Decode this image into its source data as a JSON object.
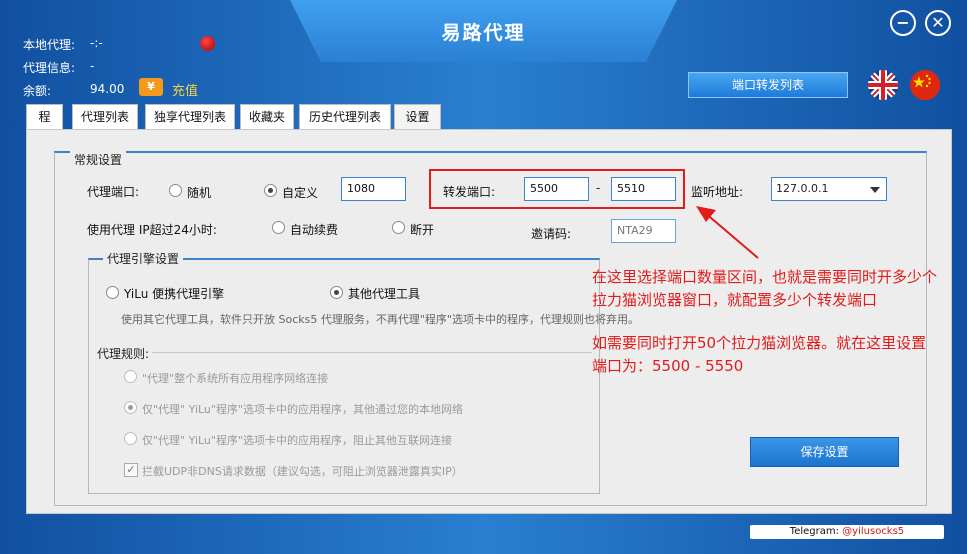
{
  "window": {
    "title": "易路代理",
    "minimize": "−",
    "close": "✕"
  },
  "info": {
    "local_proxy_label": "本地代理:",
    "local_proxy_value": "-:-",
    "proxy_info_label": "代理信息:",
    "proxy_info_value": "-",
    "balance_label": "余额:",
    "balance_value": "94.00",
    "recharge_icon_text": "¥",
    "recharge_label": "充值"
  },
  "header": {
    "port_forward_list_button": "端口转发列表"
  },
  "tabs": [
    {
      "label": "程序"
    },
    {
      "label": "代理列表"
    },
    {
      "label": "独享代理列表"
    },
    {
      "label": "收藏夹"
    },
    {
      "label": "历史代理列表"
    },
    {
      "label": "设置",
      "active": true
    }
  ],
  "general": {
    "legend": "常规设置",
    "proxy_port_label": "代理端口:",
    "random_label": "随机",
    "custom_label": "自定义",
    "custom_port_value": "1080",
    "forward_port_label": "转发端口:",
    "forward_port_start": "5500",
    "forward_port_dash": "-",
    "forward_port_end": "5510",
    "listen_addr_label": "监听地址:",
    "listen_addr_value": "127.0.0.1",
    "over24_label": "使用代理 IP超过24小时:",
    "auto_renew_label": "自动续费",
    "disconnect_label": "断开",
    "invite_label": "邀请码:",
    "invite_value": "NTA29"
  },
  "engine": {
    "legend": "代理引擎设置",
    "yilu_label": "YiLu 便携代理引擎",
    "other_label": "其他代理工具",
    "hint": "使用其它代理工具，软件只开放 Socks5 代理服务，不再代理\"程序\"选项卡中的程序，代理规则也将弃用。",
    "rules_label": "代理规则:",
    "rule1": "\"代理\"整个系统所有应用程序网络连接",
    "rule2": "仅\"代理\" YiLu\"程序\"选项卡中的应用程序，其他通过您的本地网络",
    "rule3": "仅\"代理\" YiLu\"程序\"选项卡中的应用程序，阻止其他互联网连接",
    "intercept_label": "拦截UDP非DNS请求数据（建议勾选，可阻止浏览器泄露真实IP）"
  },
  "save_button": "保存设置",
  "annotations": {
    "line1": "在这里选择端口数量区间，也就是需要同时开多少个",
    "line2": "拉力猫浏览器窗口，就配置多少个转发端口",
    "line3": "如需要同时打开50个拉力猫浏览器。就在这里设置",
    "line4": "端口为：5500 - 5550"
  },
  "telegram": {
    "label": "Telegram: ",
    "handle": "@yilusocks5"
  },
  "colors": {
    "accent_blue": "#2b80d4",
    "annotation_red": "#e21b1b"
  }
}
